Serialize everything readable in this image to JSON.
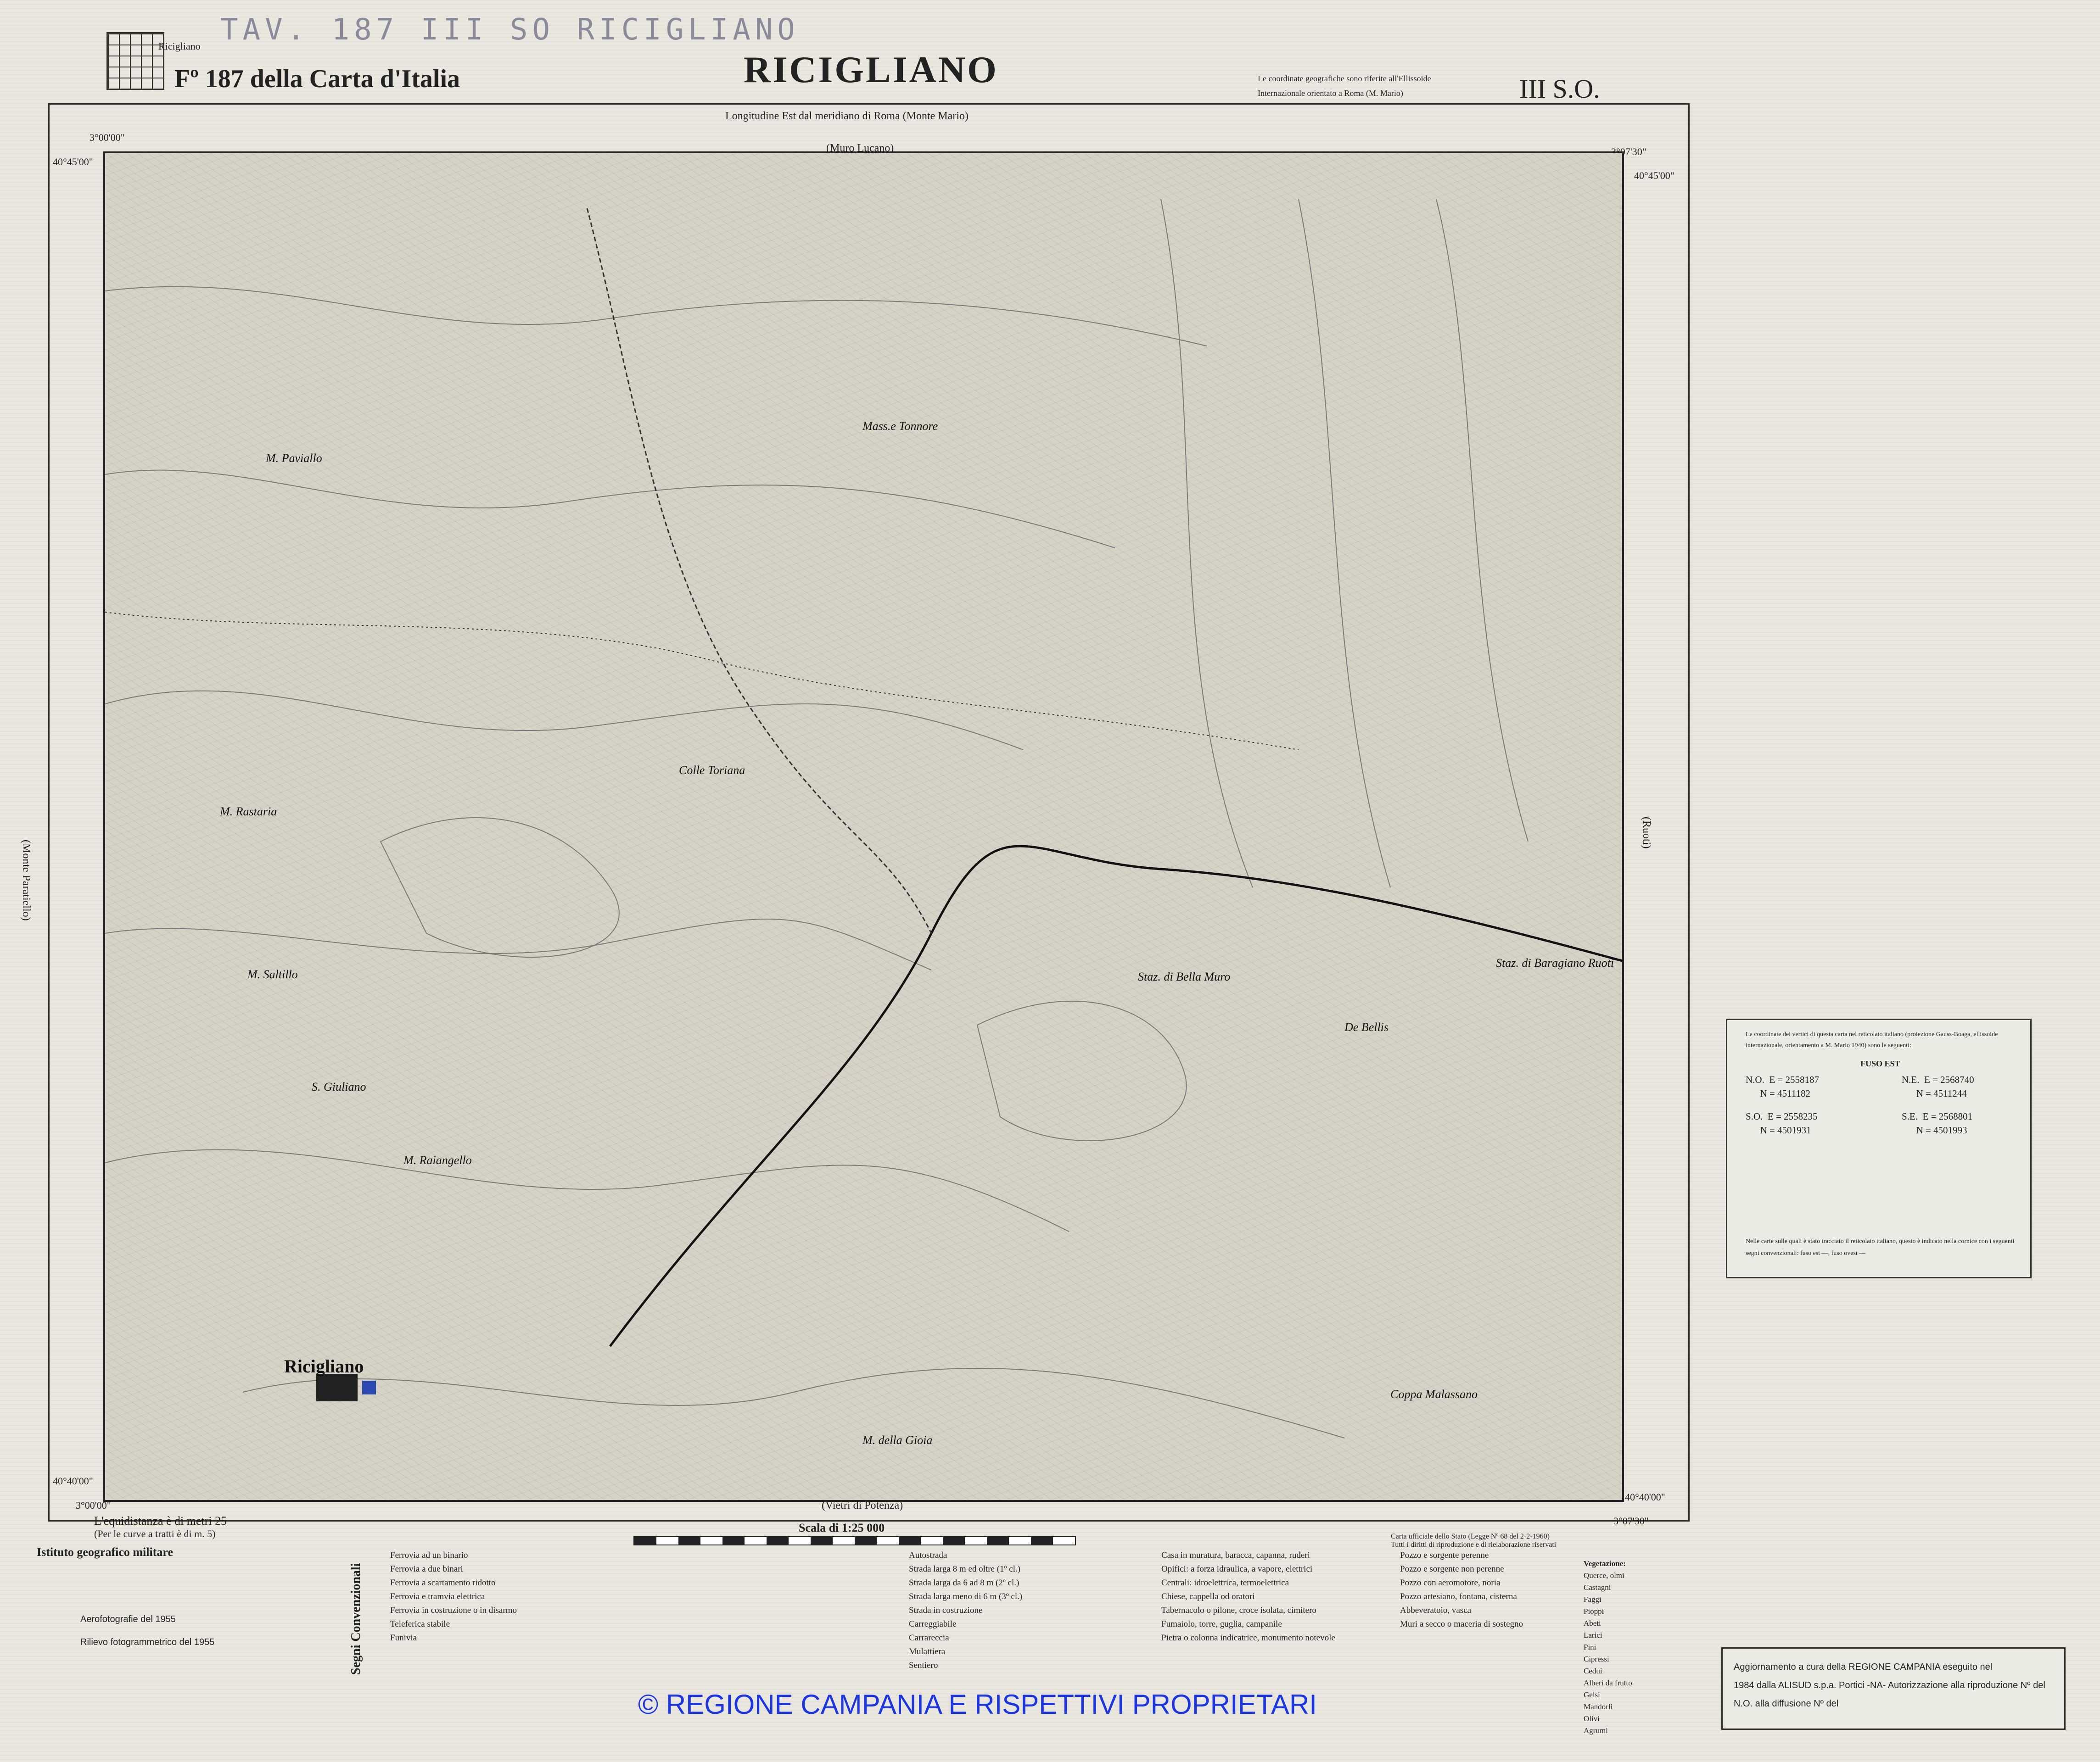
{
  "header": {
    "archive_stamp": "TAV. 187 III SO RICIGLIANO",
    "index_label": "Ricigliano",
    "sheet_number": "Fº 187 della Carta d'Italia",
    "title": "RICIGLIANO",
    "coord_note_1": "Le coordinate geografiche sono riferite all'Ellissoide",
    "coord_note_2": "Internazionale orientato a Roma (M. Mario)",
    "quadrant": "III S.O.",
    "meridian_note": "Longitudine Est dal meridiano di Roma (Monte Mario)"
  },
  "frame": {
    "lon_left": "3°00'00\"",
    "lon_right": "3°07'30\"",
    "lat_top": "40°45'00\"",
    "lat_bottom": "40°40'00\"",
    "adjacent_north": "(Muro Lucano)",
    "adjacent_south": "(Vietri di Potenza)",
    "adjacent_west": "(Monte Paratiello)",
    "adjacent_east": "(Ruoti)"
  },
  "places": [
    "Ricigliano",
    "Colle Toriana",
    "Mass.e Tonnore",
    "M. Rastaria",
    "M. Saltillo",
    "S. Giuliano",
    "M. Raiangello",
    "M. Paviallo",
    "De Bellis",
    "Staz. di Bella Muro",
    "Staz. di Baragiano Ruoti",
    "Coppa Malassano",
    "M. della Gioia"
  ],
  "grid_box": {
    "intro": "Le coordinate dei vertici di questa carta nel reticolato italiano (proiezione Gauss-Boaga, ellissoide internazionale, orientamento a M. Mario 1940) sono le seguenti:",
    "fuso": "FUSO EST",
    "no": {
      "label": "N.O.",
      "e": "E = 2558187",
      "n": "N = 4511182"
    },
    "ne": {
      "label": "N.E.",
      "e": "E = 2568740",
      "n": "N = 4511244"
    },
    "so": {
      "label": "S.O.",
      "e": "E = 2558235",
      "n": "N = 4501931"
    },
    "se": {
      "label": "S.E.",
      "e": "E = 2568801",
      "n": "N = 4501993"
    },
    "footer": "Nelle carte sulle quali è stato tracciato il reticolato italiano, questo è indicato nella cornice con i seguenti segni convenzionali: fuso est —, fuso ovest —"
  },
  "footer": {
    "equidistance": "L'equidistanza è di metri 25",
    "equidistance_note": "(Per le curve a tratti è di m. 5)",
    "publisher": "Istituto geografico militare",
    "aerial": "Aerofotografie del 1955",
    "survey": "Rilievo fotogrammetrico del 1955",
    "scale": "Scala di 1:25 000",
    "official_1": "Carta ufficiale dello Stato (Legge Nº 68 del 2-2-1960)",
    "official_2": "Tutti i diritti di riproduzione e di rielaborazione riservati"
  },
  "legend": {
    "title": "Segni Convenzionali",
    "railways": [
      "Ferrovia ad un binario",
      "Ferrovia a due binari",
      "Ferrovia a scartamento ridotto",
      "Ferrovia e tramvia elettrica",
      "Ferrovia in costruzione o in disarmo",
      "Teleferica stabile",
      "Funivia"
    ],
    "roads": [
      "Autostrada",
      "Strada larga 8 m ed oltre (1º cl.)",
      "Strada larga da 6 ad 8 m (2º cl.)",
      "Strada larga meno di 6 m (3º cl.)",
      "Strada in costruzione",
      "Carreggiabile",
      "Carrareccia",
      "Mulattiera",
      "Sentiero"
    ],
    "buildings": [
      "Casa in muratura, baracca, capanna, ruderi",
      "Opifici: a forza idraulica, a vapore, elettrici",
      "Centrali: idroelettrica, termoelettrica",
      "Chiese, cappella od oratori",
      "Tabernacolo o pilone, croce isolata, cimitero",
      "Fumaiolo, torre, guglia, campanile",
      "Pietra o colonna indicatrice, monumento notevole"
    ],
    "water": [
      "Pozzo e sorgente perenne",
      "Pozzo e sorgente non perenne",
      "Pozzo con aeromotore, noria",
      "Pozzo artesiano, fontana, cisterna",
      "Abbeveratoio, vasca",
      "Muri a secco o maceria di sostegno"
    ],
    "vegetation_title": "Vegetazione:",
    "vegetation": [
      "Querce, olmi",
      "Castagni",
      "Faggi",
      "Pioppi",
      "Abeti",
      "Larici",
      "Pini",
      "Cipressi",
      "Cedui",
      "Alberi da frutto",
      "Gelsi",
      "Mandorli",
      "Olivi",
      "Agrumi"
    ]
  },
  "update": {
    "line1": "Aggiornamento a cura della REGIONE CAMPANIA eseguito nel",
    "line2": "1984 dalla ALISUD s.p.a. Portici -NA- Autorizzazione alla riproduzione Nº del",
    "line3": "N.O. alla diffusione Nº del"
  },
  "copyright": "© REGIONE CAMPANIA E RISPETTIVI PROPRIETARI"
}
